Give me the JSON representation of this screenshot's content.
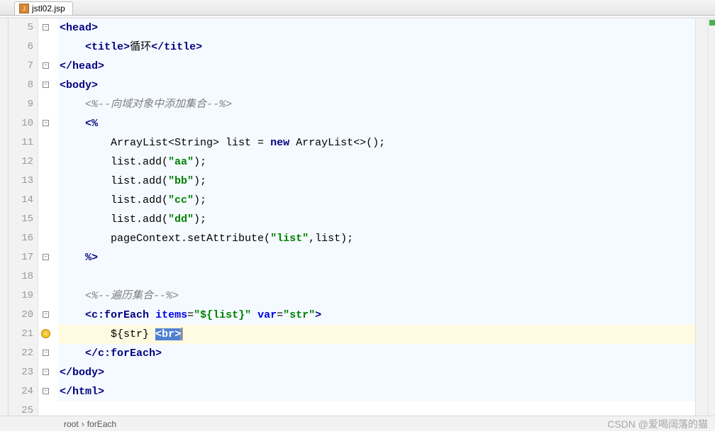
{
  "tab": {
    "filename": "jstl02.jsp"
  },
  "lines": {
    "start": 5,
    "count": 21
  },
  "code": {
    "l5": {
      "indent": "",
      "open": "<",
      "tag": "head",
      "close": ">"
    },
    "l6": {
      "indent": "    ",
      "open1": "<",
      "tag1": "title",
      "close1": ">",
      "text": "循环",
      "open2": "</",
      "tag2": "title",
      "close2": ">"
    },
    "l7": {
      "indent": "",
      "open": "</",
      "tag": "head",
      "close": ">"
    },
    "l8": {
      "indent": "",
      "open": "<",
      "tag": "body",
      "close": ">"
    },
    "l9": {
      "indent": "    ",
      "comment": "<%--向域对象中添加集合--%>"
    },
    "l10": {
      "indent": "    ",
      "scriptlet_open": "<%"
    },
    "l11": {
      "indent": "        ",
      "pt1": "ArrayList<String> list = ",
      "kw": "new",
      "pt2": " ArrayList<>();"
    },
    "l12": {
      "indent": "        ",
      "pt1": "list.add(",
      "str": "\"aa\"",
      "pt2": ");"
    },
    "l13": {
      "indent": "        ",
      "pt1": "list.add(",
      "str": "\"bb\"",
      "pt2": ");"
    },
    "l14": {
      "indent": "        ",
      "pt1": "list.add(",
      "str": "\"cc\"",
      "pt2": ");"
    },
    "l15": {
      "indent": "        ",
      "pt1": "list.add(",
      "str": "\"dd\"",
      "pt2": ");"
    },
    "l16": {
      "indent": "        ",
      "pt1": "pageContext.setAttribute(",
      "str": "\"list\"",
      "pt2": ",list);"
    },
    "l17": {
      "indent": "    ",
      "scriptlet_close": "%>"
    },
    "l19": {
      "indent": "    ",
      "comment": "<%--遍历集合--%>"
    },
    "l20": {
      "indent": "    ",
      "open": "<",
      "tag": "c:forEach",
      "sp": " ",
      "attr1": "items",
      "eq": "=",
      "val1": "\"${list}\"",
      "sp2": " ",
      "attr2": "var",
      "val2": "\"str\"",
      "close": ">"
    },
    "l21": {
      "indent": "        ",
      "expr": "${str} ",
      "sel_open": "<",
      "sel_tag": "br",
      "sel_close": ">"
    },
    "l22": {
      "indent": "    ",
      "open": "</",
      "tag": "c:forEach",
      "close": ">"
    },
    "l23": {
      "indent": "",
      "open": "</",
      "tag": "body",
      "close": ">"
    },
    "l24": {
      "indent": "",
      "open": "</",
      "tag": "html",
      "close": ">"
    }
  },
  "breadcrumb": {
    "p1": "root",
    "sep": "›",
    "p2": "forEach"
  },
  "watermark": "CSDN @爱喝阔落的猫"
}
